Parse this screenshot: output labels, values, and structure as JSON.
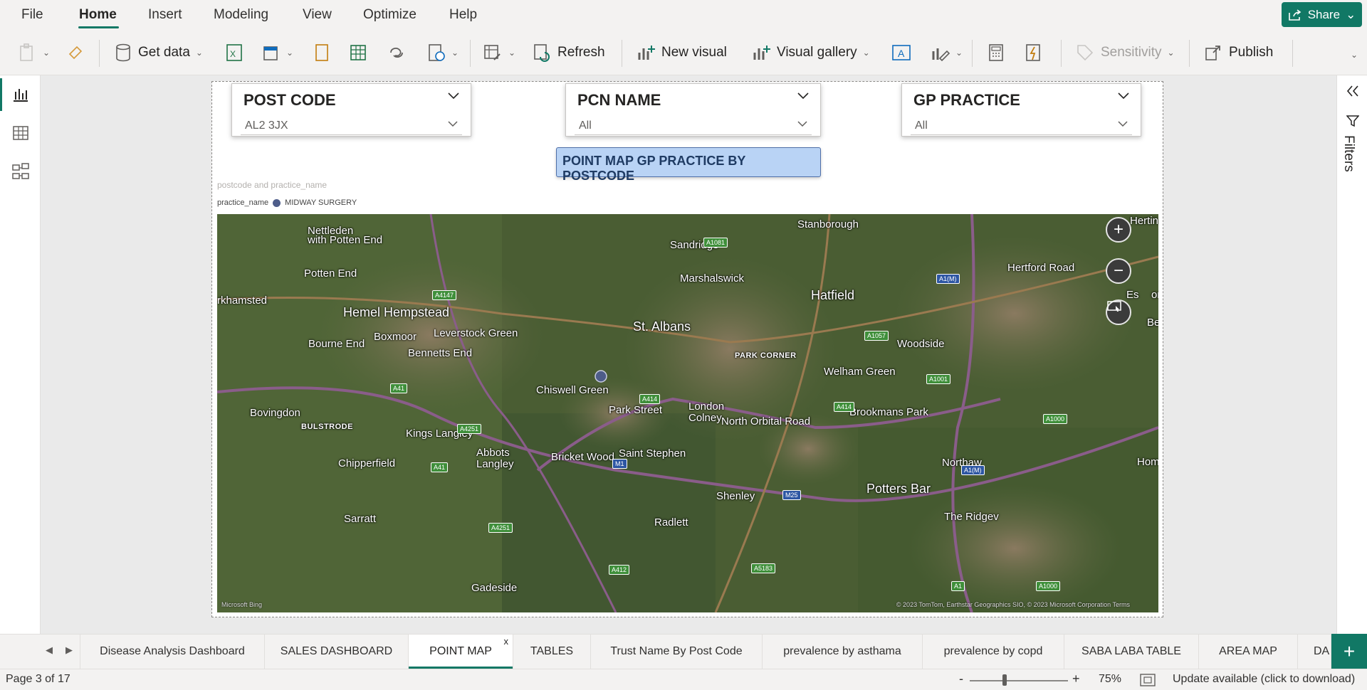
{
  "menu": {
    "items": [
      "File",
      "Home",
      "Insert",
      "Modeling",
      "View",
      "Optimize",
      "Help"
    ],
    "active": "Home",
    "share_label": "Share"
  },
  "ribbon": {
    "get_data": "Get data",
    "refresh": "Refresh",
    "new_visual": "New visual",
    "visual_gallery": "Visual gallery",
    "sensitivity": "Sensitivity",
    "publish": "Publish"
  },
  "slicers": [
    {
      "title": "POST CODE",
      "value": "AL2 3JX"
    },
    {
      "title": "PCN NAME",
      "value": "All"
    },
    {
      "title": "GP PRACTICE",
      "value": "All"
    }
  ],
  "title_button": "POINT MAP GP PRACTICE BY POSTCODE",
  "map_visual": {
    "caption": "postcode and practice_name",
    "legend_field": "practice_name",
    "legend_item": "MIDWAY SURGERY",
    "point_color": "#4e5d8a",
    "places": [
      "Nettleden",
      "with Potten End",
      "Potten End",
      "rkhamsted",
      "Hemel Hempstead",
      "Boxmoor",
      "Leverstock Green",
      "Bourne End",
      "Bennetts End",
      "Bovingdon",
      "BULSTRODE",
      "Kings Langley",
      "Chipperfield",
      "Sarratt",
      "Abbots",
      "Langley",
      "Chiswell Green",
      "Bricket Wood",
      "Park Street",
      "Saint Stephen",
      "London",
      "Colney",
      "St. Albans",
      "Sandridge",
      "Marshalswick",
      "Stanborough",
      "Hatfield",
      "PARK CORNER",
      "Welham Green",
      "Woodside",
      "Brookmans Park",
      "Shenley",
      "Radlett",
      "Potters Bar",
      "Northaw",
      "The Ridgev",
      "Hertin",
      "Es",
      "on",
      "Ber",
      "Hom",
      "North Orbital Road",
      "Hertford Road",
      "Gadeside"
    ],
    "roads": [
      "A1081",
      "A4147",
      "A41",
      "A4251",
      "A414",
      "A41",
      "M1",
      "A4251",
      "A412",
      "A5183",
      "M25",
      "A1057",
      "A1(M)",
      "A1001",
      "A414",
      "A1(M)",
      "A1000",
      "A1",
      "A1000"
    ],
    "attribution": "© 2023 TomTom, Earthstar Geographics SIO, © 2023 Microsoft Corporation  Terms",
    "logo": "Microsoft Bing"
  },
  "filters_label": "Filters",
  "tabs": [
    "Disease Analysis Dashboard",
    "SALES DASHBOARD",
    "POINT MAP",
    "TABLES",
    "Trust Name By Post Code",
    "prevalence by asthama",
    "prevalence by copd",
    "SABA LABA TABLE",
    "AREA MAP",
    "DA"
  ],
  "active_tab": "POINT MAP",
  "status": {
    "page": "Page 3 of 17",
    "zoom_value": "75%",
    "update": "Update available (click to download)"
  },
  "colors": {
    "accent": "#117865",
    "button_bg": "#b9d3f5"
  }
}
